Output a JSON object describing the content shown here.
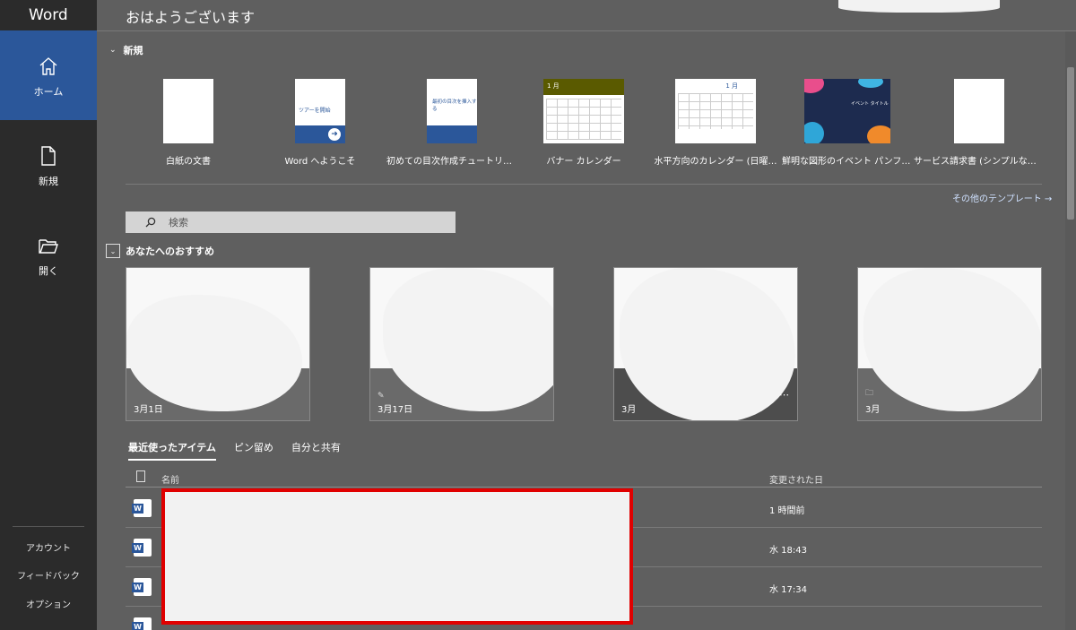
{
  "app": {
    "name": "Word"
  },
  "sidebar": {
    "nav": [
      {
        "label": "ホーム",
        "icon": "home-icon",
        "active": true
      },
      {
        "label": "新規",
        "icon": "new-document-icon",
        "active": false
      },
      {
        "label": "開く",
        "icon": "folder-open-icon",
        "active": false
      }
    ],
    "bottom": [
      "アカウント",
      "フィードバック",
      "オプション"
    ]
  },
  "header": {
    "greeting": "おはようございます"
  },
  "new_section": {
    "title": "新規",
    "templates": [
      {
        "label": "白紙の文書"
      },
      {
        "label": "Word へようこそ",
        "thumb_text": "ツアーを開始"
      },
      {
        "label": "初めての目次作成チュートリアル",
        "thumb_text": "最初の目次を挿入する"
      },
      {
        "label": "バナー カレンダー",
        "thumb_text": "1 月"
      },
      {
        "label": "水平方向のカレンダー (日曜…",
        "thumb_text": "1 月"
      },
      {
        "label": "鮮明な図形のイベント パンフレ…",
        "thumb_text": "イベント タイトル"
      },
      {
        "label": "サービス請求書 (シンプルな線…"
      }
    ],
    "more_link": "その他のテンプレート →"
  },
  "search": {
    "placeholder": "検索"
  },
  "recommended": {
    "title": "あなたへのおすすめ",
    "cards": [
      {
        "date": "3月1日"
      },
      {
        "date": "3月17日"
      },
      {
        "date": "3月"
      },
      {
        "date": "3月"
      }
    ]
  },
  "tabs": [
    {
      "label": "最近使ったアイテム",
      "active": true
    },
    {
      "label": "ピン留め",
      "active": false
    },
    {
      "label": "自分と共有",
      "active": false
    }
  ],
  "file_list": {
    "col_name": "名前",
    "col_modified": "変更された日",
    "rows": [
      {
        "modified": "1 時間前"
      },
      {
        "modified": "水 18:43"
      },
      {
        "modified": "水 17:34"
      }
    ]
  },
  "colors": {
    "accent": "#2b579a",
    "sidebar": "#2b2b2b",
    "background": "#5f5f5f",
    "redaction_box": "#e00000"
  }
}
